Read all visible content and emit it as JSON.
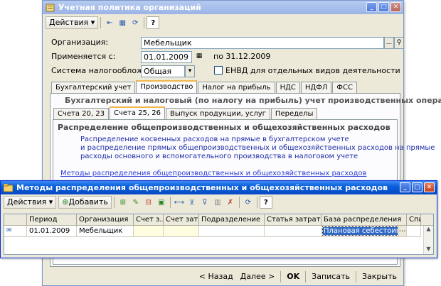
{
  "main_window": {
    "title": "Учетная политика организаций",
    "actions_label": "Действия",
    "org_label": "Организация:",
    "org_value": "Мебельщик",
    "applies_label": "Применяется с:",
    "applies_value": "01.01.2009",
    "applies_to": "по 31.12.2009",
    "tax_system_label": "Система налогообложения:",
    "tax_system_value": "Общая",
    "envd_label": "ЕНВД для отдельных видов деятельности",
    "tabs": [
      "Бухгалтерский учет",
      "Производство",
      "Налог на прибыль",
      "НДС",
      "НДФЛ",
      "ФСС"
    ],
    "section_header": "Бухгалтерский и налоговый (по налогу на прибыль) учет производственных операций",
    "subtabs": [
      "Счета 20, 23",
      "Счета 25, 26",
      "Выпуск продукции, услуг",
      "Переделы"
    ],
    "dist_header": "Распределение общепроизводственных и общехозяйственных расходов",
    "dist_text_1": "Распределение косвенных расходов на прямые в бухгалтерском учете",
    "dist_text_2": "и распределение прямых общепроизводственных и общехозяйственных расходов на прямые",
    "dist_text_3": "расходы основного и вспомогательного производства в налоговом учете",
    "dist_link": "Методы распределения общепроизводственных и общехозяйственных расходов",
    "footer": {
      "back": "< Назад",
      "next": "Далее >",
      "ok": "OK",
      "save": "Записать",
      "close": "Закрыть"
    }
  },
  "dialog": {
    "title": "Методы распределения общепроизводственных и общехозяйственных расходов",
    "actions_label": "Действия",
    "add_label": "Добавить",
    "columns": [
      "Период",
      "Организация",
      "Счет з...",
      "Счет зат...",
      "Подразделение",
      "Статья затрат",
      "База распределения",
      "Спис"
    ],
    "rows": [
      {
        "period": "01.01.2009",
        "org": "Мебельщик",
        "acc1": "",
        "acc2": "",
        "dept": "",
        "item": "",
        "base": "Плановая себестоимос"
      }
    ]
  },
  "colors": {
    "title_bar": "#0a5fd8",
    "title_bar_inactive": "#a8bfe8",
    "link": "#2b3bd6",
    "selection": "#316ac5"
  }
}
